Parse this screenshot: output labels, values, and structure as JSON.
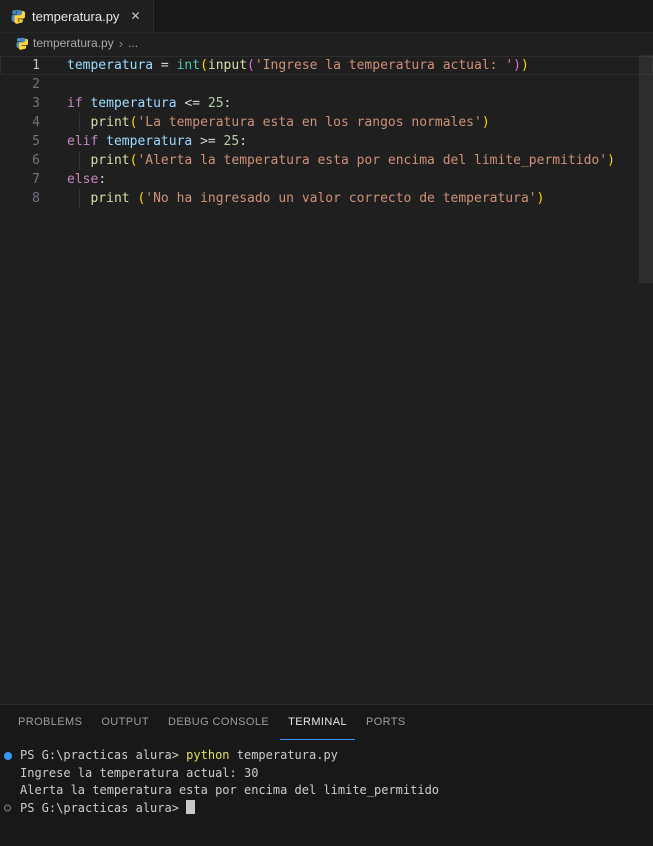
{
  "colors": {
    "editor_bg": "#1f1f1f",
    "panel_bg": "#181818",
    "accent_blue": "#3794ff",
    "keyword": "#c586c0",
    "variable": "#9cdcfe",
    "class_name": "#4ec9b0",
    "function_name": "#dcdcaa",
    "string": "#ce9178",
    "number": "#b5cea8",
    "bracket_outer": "#ffd700",
    "bracket_inner": "#da70d6",
    "terminal_command_yellow": "#e0e060"
  },
  "tab_bar": {
    "tabs": [
      {
        "label": "temperatura.py",
        "icon": "python-icon",
        "active": true,
        "close_glyph": "✕"
      }
    ]
  },
  "breadcrumb": {
    "file": "temperatura.py",
    "separator": "›",
    "tail": "..."
  },
  "editor": {
    "lines": [
      {
        "num": 1,
        "active": true,
        "guide": false,
        "tokens": [
          {
            "text": "temperatura",
            "style": "variable"
          },
          {
            "text": " ",
            "style": "plain"
          },
          {
            "text": "=",
            "style": "operator"
          },
          {
            "text": " ",
            "style": "plain"
          },
          {
            "text": "int",
            "style": "class"
          },
          {
            "text": "(",
            "style": "bracket1"
          },
          {
            "text": "input",
            "style": "function"
          },
          {
            "text": "(",
            "style": "bracket2"
          },
          {
            "text": "'Ingrese la temperatura actual: '",
            "style": "string"
          },
          {
            "text": ")",
            "style": "bracket2"
          },
          {
            "text": ")",
            "style": "bracket1"
          }
        ]
      },
      {
        "num": 2,
        "active": false,
        "guide": false,
        "tokens": []
      },
      {
        "num": 3,
        "active": false,
        "guide": false,
        "tokens": [
          {
            "text": "if",
            "style": "keyword"
          },
          {
            "text": " ",
            "style": "plain"
          },
          {
            "text": "temperatura",
            "style": "variable"
          },
          {
            "text": " ",
            "style": "plain"
          },
          {
            "text": "<=",
            "style": "operator"
          },
          {
            "text": " ",
            "style": "plain"
          },
          {
            "text": "25",
            "style": "number"
          },
          {
            "text": ":",
            "style": "operator"
          }
        ]
      },
      {
        "num": 4,
        "active": false,
        "guide": true,
        "tokens": [
          {
            "text": "   ",
            "style": "plain"
          },
          {
            "text": "print",
            "style": "function"
          },
          {
            "text": "(",
            "style": "bracket1"
          },
          {
            "text": "'La temperatura esta en los rangos normales'",
            "style": "string"
          },
          {
            "text": ")",
            "style": "bracket1"
          }
        ]
      },
      {
        "num": 5,
        "active": false,
        "guide": false,
        "tokens": [
          {
            "text": "elif",
            "style": "keyword"
          },
          {
            "text": " ",
            "style": "plain"
          },
          {
            "text": "temperatura",
            "style": "variable"
          },
          {
            "text": " ",
            "style": "plain"
          },
          {
            "text": ">=",
            "style": "operator"
          },
          {
            "text": " ",
            "style": "plain"
          },
          {
            "text": "25",
            "style": "number"
          },
          {
            "text": ":",
            "style": "operator"
          }
        ]
      },
      {
        "num": 6,
        "active": false,
        "guide": true,
        "tokens": [
          {
            "text": "   ",
            "style": "plain"
          },
          {
            "text": "print",
            "style": "function"
          },
          {
            "text": "(",
            "style": "bracket1"
          },
          {
            "text": "'Alerta la temperatura esta por encima del limite_permitido'",
            "style": "string"
          },
          {
            "text": ")",
            "style": "bracket1"
          }
        ]
      },
      {
        "num": 7,
        "active": false,
        "guide": false,
        "tokens": [
          {
            "text": "else",
            "style": "keyword"
          },
          {
            "text": ":",
            "style": "operator"
          }
        ]
      },
      {
        "num": 8,
        "active": false,
        "guide": true,
        "tokens": [
          {
            "text": "   ",
            "style": "plain"
          },
          {
            "text": "print",
            "style": "function"
          },
          {
            "text": " ",
            "style": "plain"
          },
          {
            "text": "(",
            "style": "bracket1"
          },
          {
            "text": "'No ha ingresado un valor correcto de temperatura'",
            "style": "string"
          },
          {
            "text": ")",
            "style": "bracket1"
          }
        ]
      }
    ]
  },
  "panel": {
    "tabs": [
      {
        "label": "PROBLEMS",
        "active": false
      },
      {
        "label": "OUTPUT",
        "active": false
      },
      {
        "label": "DEBUG CONSOLE",
        "active": false
      },
      {
        "label": "TERMINAL",
        "active": true
      },
      {
        "label": "PORTS",
        "active": false
      }
    ],
    "terminal": {
      "lines": [
        {
          "decoration": "filled-circle",
          "cursor": false,
          "segments": [
            {
              "text": "PS G:\\practicas alura> ",
              "style": "plain"
            },
            {
              "text": "python",
              "style": "command"
            },
            {
              "text": " temperatura.py",
              "style": "plain"
            }
          ]
        },
        {
          "decoration": "none",
          "cursor": false,
          "segments": [
            {
              "text": "Ingrese la temperatura actual: 30",
              "style": "plain"
            }
          ]
        },
        {
          "decoration": "none",
          "cursor": false,
          "segments": [
            {
              "text": "Alerta la temperatura esta por encima del limite_permitido",
              "style": "plain"
            }
          ]
        },
        {
          "decoration": "hollow-circle",
          "cursor": true,
          "segments": [
            {
              "text": "PS G:\\practicas alura> ",
              "style": "plain"
            }
          ]
        }
      ]
    }
  }
}
